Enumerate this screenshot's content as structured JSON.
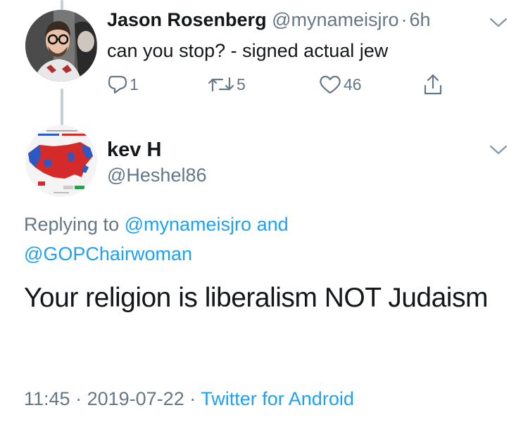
{
  "parent_tweet": {
    "display_name": "Jason Rosenberg",
    "handle": "@mynameisjro",
    "separator": "·",
    "time": "6h",
    "text": "can you stop? - signed actual jew",
    "replies": "1",
    "retweets": "5",
    "likes": "46",
    "icons": [
      "reply-icon",
      "retweet-icon",
      "heart-icon",
      "share-icon",
      "chevron-down-icon"
    ]
  },
  "reply_tweet": {
    "display_name": "kev H",
    "handle": "@Heshel86",
    "replying_prefix": "Replying to",
    "replying_to_1": "@mynameisjro",
    "replying_and": "and",
    "replying_to_2": "@GOPChairwoman",
    "text": "Your religion is liberalism NOT Judaism",
    "time": "11:45",
    "separator": "·",
    "date": "2019-07-22",
    "source": "Twitter for Android"
  },
  "colors": {
    "link": "#1da1f2",
    "secondary_text": "#657786",
    "primary_text": "#14171a",
    "thread_line": "#c4cfd6"
  }
}
